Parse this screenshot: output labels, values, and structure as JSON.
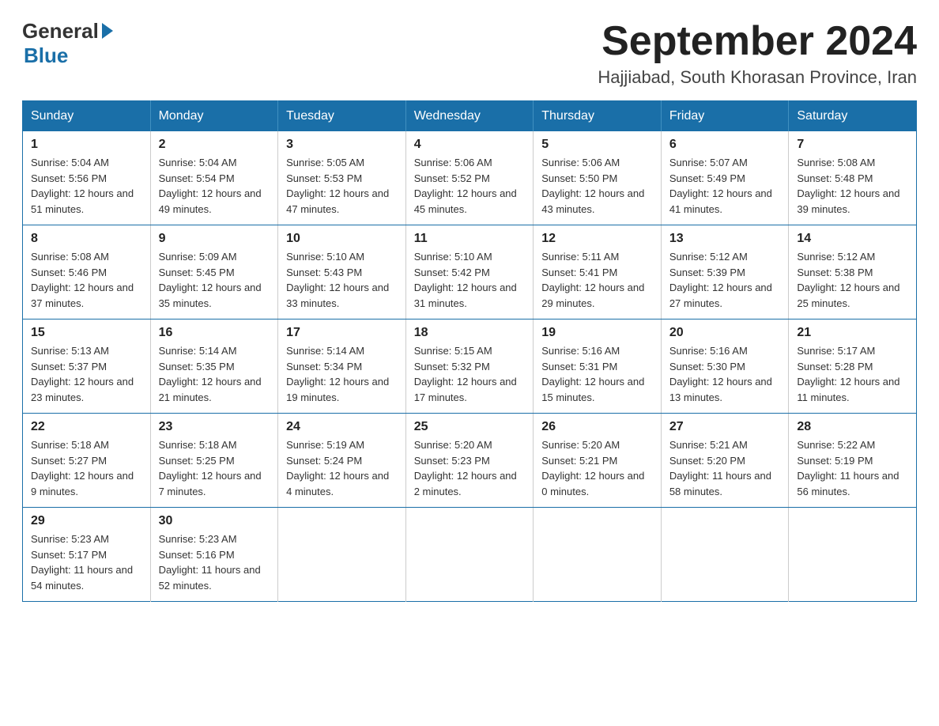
{
  "logo": {
    "general": "General",
    "blue": "Blue"
  },
  "header": {
    "month": "September 2024",
    "location": "Hajjiabad, South Khorasan Province, Iran"
  },
  "weekdays": [
    "Sunday",
    "Monday",
    "Tuesday",
    "Wednesday",
    "Thursday",
    "Friday",
    "Saturday"
  ],
  "weeks": [
    [
      {
        "day": "1",
        "sunrise": "5:04 AM",
        "sunset": "5:56 PM",
        "daylight": "12 hours and 51 minutes."
      },
      {
        "day": "2",
        "sunrise": "5:04 AM",
        "sunset": "5:54 PM",
        "daylight": "12 hours and 49 minutes."
      },
      {
        "day": "3",
        "sunrise": "5:05 AM",
        "sunset": "5:53 PM",
        "daylight": "12 hours and 47 minutes."
      },
      {
        "day": "4",
        "sunrise": "5:06 AM",
        "sunset": "5:52 PM",
        "daylight": "12 hours and 45 minutes."
      },
      {
        "day": "5",
        "sunrise": "5:06 AM",
        "sunset": "5:50 PM",
        "daylight": "12 hours and 43 minutes."
      },
      {
        "day": "6",
        "sunrise": "5:07 AM",
        "sunset": "5:49 PM",
        "daylight": "12 hours and 41 minutes."
      },
      {
        "day": "7",
        "sunrise": "5:08 AM",
        "sunset": "5:48 PM",
        "daylight": "12 hours and 39 minutes."
      }
    ],
    [
      {
        "day": "8",
        "sunrise": "5:08 AM",
        "sunset": "5:46 PM",
        "daylight": "12 hours and 37 minutes."
      },
      {
        "day": "9",
        "sunrise": "5:09 AM",
        "sunset": "5:45 PM",
        "daylight": "12 hours and 35 minutes."
      },
      {
        "day": "10",
        "sunrise": "5:10 AM",
        "sunset": "5:43 PM",
        "daylight": "12 hours and 33 minutes."
      },
      {
        "day": "11",
        "sunrise": "5:10 AM",
        "sunset": "5:42 PM",
        "daylight": "12 hours and 31 minutes."
      },
      {
        "day": "12",
        "sunrise": "5:11 AM",
        "sunset": "5:41 PM",
        "daylight": "12 hours and 29 minutes."
      },
      {
        "day": "13",
        "sunrise": "5:12 AM",
        "sunset": "5:39 PM",
        "daylight": "12 hours and 27 minutes."
      },
      {
        "day": "14",
        "sunrise": "5:12 AM",
        "sunset": "5:38 PM",
        "daylight": "12 hours and 25 minutes."
      }
    ],
    [
      {
        "day": "15",
        "sunrise": "5:13 AM",
        "sunset": "5:37 PM",
        "daylight": "12 hours and 23 minutes."
      },
      {
        "day": "16",
        "sunrise": "5:14 AM",
        "sunset": "5:35 PM",
        "daylight": "12 hours and 21 minutes."
      },
      {
        "day": "17",
        "sunrise": "5:14 AM",
        "sunset": "5:34 PM",
        "daylight": "12 hours and 19 minutes."
      },
      {
        "day": "18",
        "sunrise": "5:15 AM",
        "sunset": "5:32 PM",
        "daylight": "12 hours and 17 minutes."
      },
      {
        "day": "19",
        "sunrise": "5:16 AM",
        "sunset": "5:31 PM",
        "daylight": "12 hours and 15 minutes."
      },
      {
        "day": "20",
        "sunrise": "5:16 AM",
        "sunset": "5:30 PM",
        "daylight": "12 hours and 13 minutes."
      },
      {
        "day": "21",
        "sunrise": "5:17 AM",
        "sunset": "5:28 PM",
        "daylight": "12 hours and 11 minutes."
      }
    ],
    [
      {
        "day": "22",
        "sunrise": "5:18 AM",
        "sunset": "5:27 PM",
        "daylight": "12 hours and 9 minutes."
      },
      {
        "day": "23",
        "sunrise": "5:18 AM",
        "sunset": "5:25 PM",
        "daylight": "12 hours and 7 minutes."
      },
      {
        "day": "24",
        "sunrise": "5:19 AM",
        "sunset": "5:24 PM",
        "daylight": "12 hours and 4 minutes."
      },
      {
        "day": "25",
        "sunrise": "5:20 AM",
        "sunset": "5:23 PM",
        "daylight": "12 hours and 2 minutes."
      },
      {
        "day": "26",
        "sunrise": "5:20 AM",
        "sunset": "5:21 PM",
        "daylight": "12 hours and 0 minutes."
      },
      {
        "day": "27",
        "sunrise": "5:21 AM",
        "sunset": "5:20 PM",
        "daylight": "11 hours and 58 minutes."
      },
      {
        "day": "28",
        "sunrise": "5:22 AM",
        "sunset": "5:19 PM",
        "daylight": "11 hours and 56 minutes."
      }
    ],
    [
      {
        "day": "29",
        "sunrise": "5:23 AM",
        "sunset": "5:17 PM",
        "daylight": "11 hours and 54 minutes."
      },
      {
        "day": "30",
        "sunrise": "5:23 AM",
        "sunset": "5:16 PM",
        "daylight": "11 hours and 52 minutes."
      },
      null,
      null,
      null,
      null,
      null
    ]
  ]
}
